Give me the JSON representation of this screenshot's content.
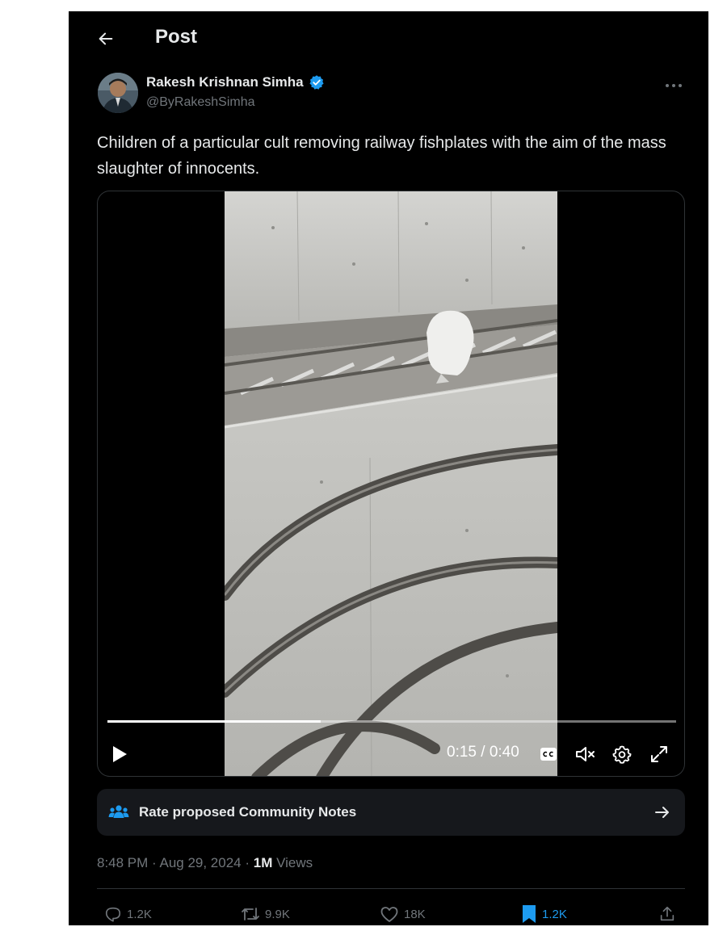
{
  "header": {
    "title": "Post"
  },
  "author": {
    "name": "Rakesh Krishnan Simha",
    "handle": "@ByRakeshSimha",
    "verified": true
  },
  "post": {
    "text": "Children of a particular cult removing railway fishplates with the aim of the mass slaughter of innocents."
  },
  "video": {
    "time_display": "0:15 / 0:40",
    "progress_fraction": 0.375,
    "controls": [
      "play-icon",
      "cc-icon",
      "volume-mute-icon",
      "gear-icon",
      "expand-icon"
    ]
  },
  "community_notes": {
    "label": "Rate proposed Community Notes"
  },
  "meta": {
    "timestamp": "8:48 PM · Aug 29, 2024 · ",
    "views_count": "1M",
    "views_label": " Views"
  },
  "actions": {
    "replies": "1.2K",
    "reposts": "9.9K",
    "likes": "18K",
    "bookmarks": "1.2K"
  },
  "colors": {
    "background": "#000000",
    "text": "#e7e9ea",
    "muted": "#71767b",
    "accent": "#1d9bf0",
    "border": "#2f3336"
  }
}
